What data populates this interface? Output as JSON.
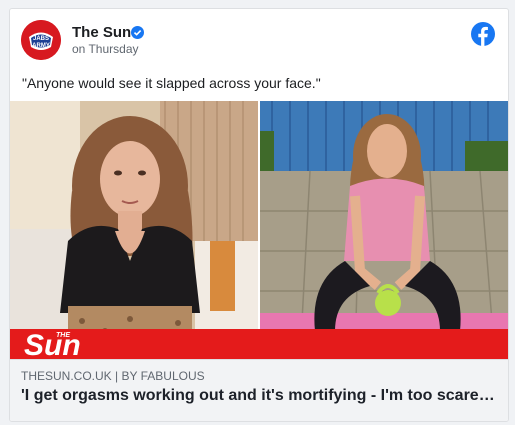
{
  "post": {
    "page_name": "The Sun",
    "avatar_text_top": "JABS",
    "avatar_text_bottom": "ARMY",
    "timestamp": "on Thursday",
    "text": "\"Anyone would see it slapped across your face.\""
  },
  "media": {
    "logo_text": "Sun",
    "logo_small_text": "THE"
  },
  "link": {
    "domain": "THESUN.CO.UK",
    "separator": " | ",
    "by_label": "BY ",
    "author": "FABULOUS",
    "title": "'I get orgasms working out and it's mortifying - I'm too scared to go to the gym'"
  },
  "colors": {
    "brand_red": "#e41b1b",
    "facebook_blue": "#1877f2",
    "verified_blue": "#1877f2"
  },
  "icons": {
    "verified": "verified-badge-icon",
    "platform": "facebook-icon"
  }
}
